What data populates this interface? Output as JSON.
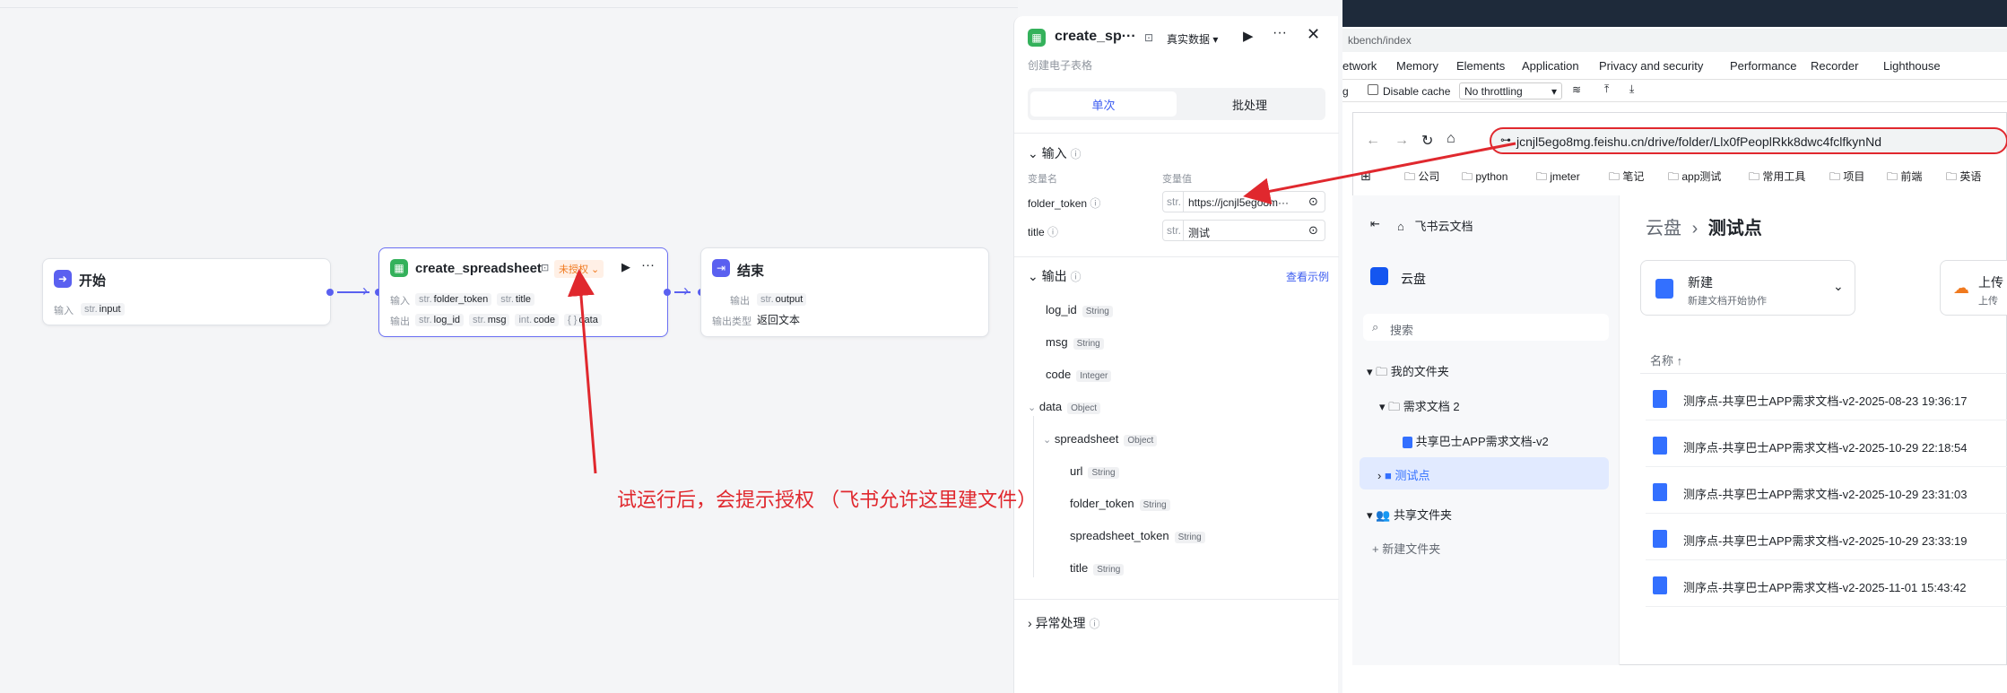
{
  "nodes": {
    "start": {
      "title": "开始",
      "input_label": "输入",
      "input_type": "str.",
      "input_name": "input"
    },
    "create": {
      "title": "create_spreadsheet",
      "badge": "未授权",
      "input_label": "输入",
      "output_label": "输出",
      "inputs": [
        {
          "type": "str.",
          "name": "folder_token"
        },
        {
          "type": "str.",
          "name": "title"
        }
      ],
      "outputs": [
        {
          "type": "str.",
          "name": "log_id"
        },
        {
          "type": "str.",
          "name": "msg"
        },
        {
          "type": "int.",
          "name": "code"
        },
        {
          "type": "{ }",
          "name": "data"
        }
      ]
    },
    "end": {
      "title": "结束",
      "output_label": "输出",
      "output_type": "str.",
      "output_name": "output",
      "otype_label": "输出类型",
      "otype_value": "返回文本"
    }
  },
  "panel": {
    "title": "create_sp···",
    "mode": "真实数据",
    "subtitle": "创建电子表格",
    "tab_single": "单次",
    "tab_batch": "批处理",
    "input_section": "输入",
    "col_name": "变量名",
    "col_value": "变量值",
    "inputs": [
      {
        "name": "folder_token",
        "type": "str.",
        "value": "https://jcnjl5ego8m···"
      },
      {
        "name": "title",
        "type": "str.",
        "value": "测试"
      }
    ],
    "output_section": "输出",
    "view_example": "查看示例",
    "outputs": [
      {
        "name": "log_id",
        "type": "String"
      },
      {
        "name": "msg",
        "type": "String"
      },
      {
        "name": "code",
        "type": "Integer"
      },
      {
        "name": "data",
        "type": "Object"
      },
      {
        "name": "spreadsheet",
        "type": "Object"
      },
      {
        "name": "url",
        "type": "String"
      },
      {
        "name": "folder_token",
        "type": "String"
      },
      {
        "name": "spreadsheet_token",
        "type": "String"
      },
      {
        "name": "title",
        "type": "String"
      }
    ],
    "error_section": "异常处理"
  },
  "devtools": {
    "url_partial": "kbench/index",
    "tabs": [
      "etwork",
      "Memory",
      "Elements",
      "Application",
      "Privacy and security",
      "Performance",
      "Recorder",
      "Lighthouse"
    ],
    "g_label": "g",
    "disable_cache": "Disable cache",
    "throttle": "No throttling"
  },
  "browser": {
    "url": "jcnjl5ego8mg.feishu.cn/drive/folder/Llx0fPeoplRkk8dwc4fclfkynNd",
    "bookmarks": [
      "公司",
      "python",
      "jmeter",
      "笔记",
      "app测试",
      "常用工具",
      "项目",
      "前端",
      "英语"
    ]
  },
  "drive": {
    "brand": "飞书云文档",
    "cloud": "云盘",
    "search": "搜索",
    "my_files": "我的文件夹",
    "folder_req": "需求文档 2",
    "doc_shared_app": "共享巴士APP需求文档-v2",
    "folder_test": "测试点",
    "shared_folders": "共享文件夹",
    "new_folder": "+ 新建文件夹",
    "breadcrumb_root": "云盘",
    "breadcrumb_current": "测试点",
    "new_title": "新建",
    "new_sub": "新建文档开始协作",
    "upload_title": "上传",
    "upload_sub": "上传",
    "col_name": "名称 ↑",
    "docs": [
      "测序点-共享巴士APP需求文档-v2-2025-08-23 19:36:17",
      "测序点-共享巴士APP需求文档-v2-2025-10-29 22:18:54",
      "测序点-共享巴士APP需求文档-v2-2025-10-29 23:31:03",
      "测序点-共享巴士APP需求文档-v2-2025-10-29 23:33:19",
      "测序点-共享巴士APP需求文档-v2-2025-11-01 15:43:42"
    ]
  },
  "annotation": "试运行后，会提示授权 （飞书允许这里建文件）",
  "colors": {
    "accent": "#5a60f0",
    "annotation": "#e0282e",
    "badge_bg": "#fff0e6",
    "badge_fg": "#f0791e"
  }
}
